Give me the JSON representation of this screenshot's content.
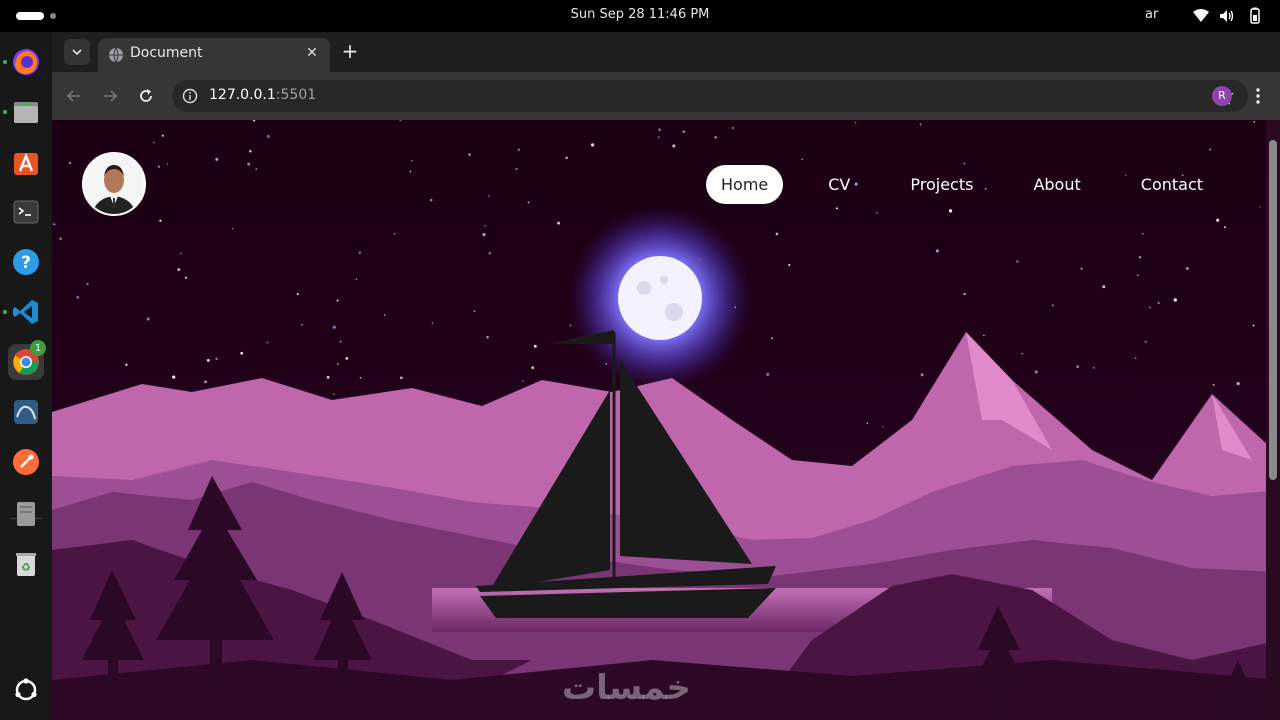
{
  "system": {
    "clock": "Sun Sep 28  11:46 PM",
    "language": "ar"
  },
  "dock": {
    "items": [
      "firefox",
      "files",
      "app-center",
      "terminal",
      "help",
      "vscode",
      "chrome",
      "mysql-workbench",
      "postman",
      "disk-image",
      "trash"
    ],
    "chrome_badge": "1"
  },
  "browser": {
    "tab_title": "Document",
    "url_host": "127.0.0.1",
    "url_port": ":5501",
    "profile_initial": "R"
  },
  "page": {
    "nav": {
      "home": "Home",
      "cv": "CV",
      "projects": "Projects",
      "about": "About",
      "contact": "Contact"
    },
    "watermark": "خمسات"
  },
  "colors": {
    "sky": "#1a0013",
    "mountain_light": "#c76bb2",
    "mountain_mid": "#9a4f93",
    "ground_dark": "#3d0d34",
    "moon_glow": "#7a6cff"
  }
}
